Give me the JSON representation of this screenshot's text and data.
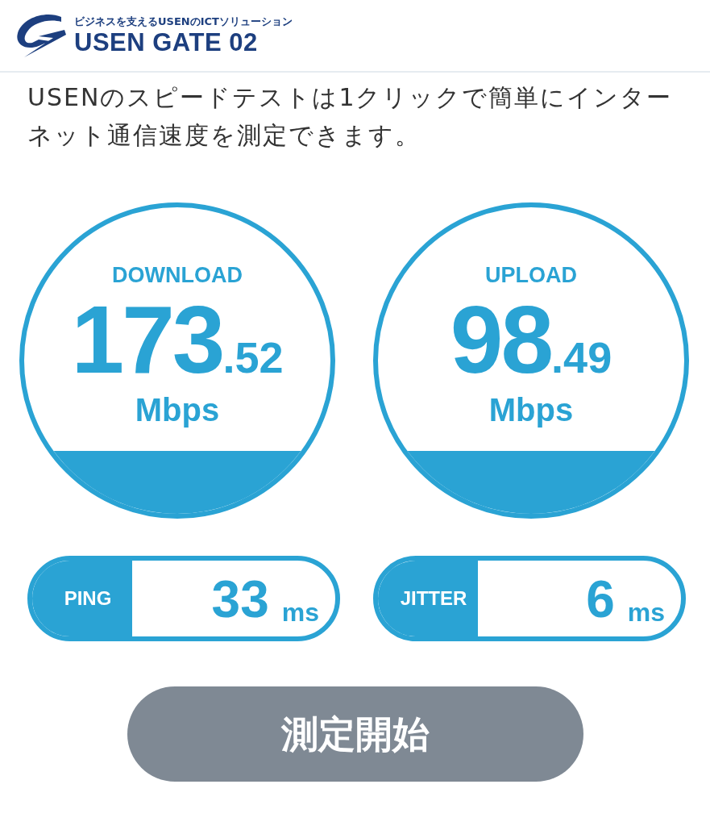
{
  "header": {
    "tagline": "ビジネスを支えるUSENのICTソリューション",
    "brand": "USEN GATE 02"
  },
  "intro": "USENのスピードテストは1クリックで簡単にインターネット通信速度を測定できます。",
  "gauges": [
    {
      "label": "DOWNLOAD",
      "integer": "173",
      "decimal": ".52",
      "unit": "Mbps"
    },
    {
      "label": "UPLOAD",
      "integer": "98",
      "decimal": ".49",
      "unit": "Mbps"
    }
  ],
  "metrics": [
    {
      "label": "PING",
      "value": "33",
      "unit": "ms"
    },
    {
      "label": "JITTER",
      "value": "6",
      "unit": "ms"
    }
  ],
  "start_button": {
    "label": "測定開始",
    "disabled": true
  }
}
